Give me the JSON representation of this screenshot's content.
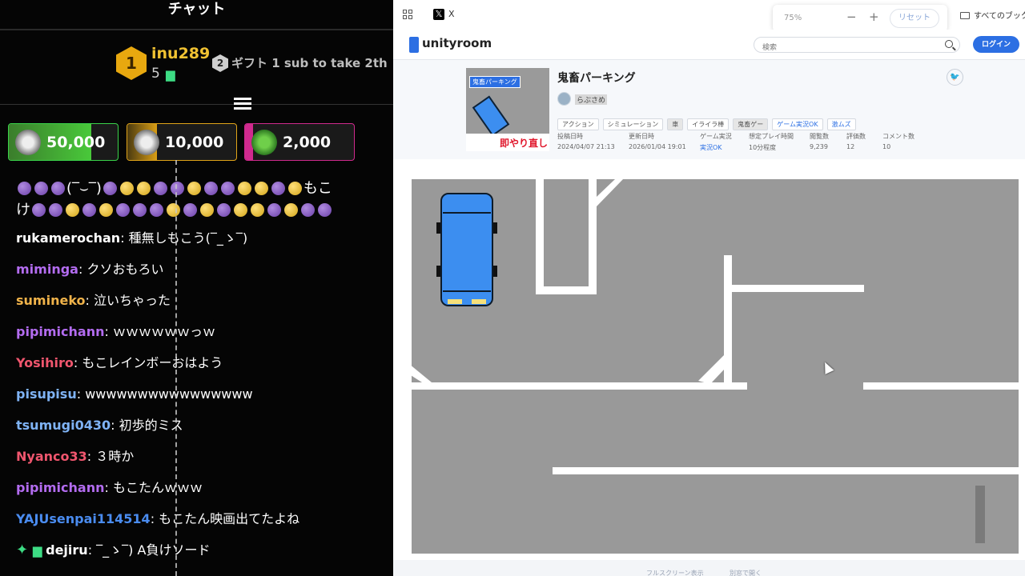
{
  "chat": {
    "title": "チャット",
    "top_gifter": {
      "rank": "1",
      "user": "inu289",
      "count": "5"
    },
    "second_gifter": {
      "rank": "2",
      "text": "ギフト 1 sub to take 2th"
    },
    "coin_boxes": [
      {
        "value": "50,000",
        "progress": 0.76,
        "color": "#49c93a"
      },
      {
        "value": "10,000",
        "progress": 0.27,
        "color": "#d99e16"
      },
      {
        "value": "2,000",
        "progress": 0.07,
        "color": "#d02a8e"
      }
    ],
    "emote_row1_text": "(‾⌣‾)",
    "emote_row1_tail": "もこ",
    "emote_row2_head": "け",
    "messages": [
      {
        "user": "rukamerochan",
        "color": "#ffffff",
        "text": "種無しもこう(‾_ゝ‾)"
      },
      {
        "user": "mimingа",
        "color": "#b36cf0",
        "text": "クソおもろい"
      },
      {
        "user": "sumineko",
        "color": "#f0b34a",
        "text": "泣いちゃった"
      },
      {
        "user": "pipimichann",
        "color": "#b36cf0",
        "text": "ｗｗｗｗｗｗっｗ"
      },
      {
        "user": "Yosihiro",
        "color": "#f0566e",
        "text": "もこレインボーおはよう"
      },
      {
        "user": "pisupisu",
        "color": "#7fb3f5",
        "text": "wwwwwwwwwwwwwwww"
      },
      {
        "user": "tsumugi0430",
        "color": "#7fb3f5",
        "text": "初歩的ミス"
      },
      {
        "user": "Nyanco33",
        "color": "#f0566e",
        "text": "３時か"
      },
      {
        "user": "pipimichann",
        "color": "#b36cf0",
        "text": "もこたんｗｗｗ"
      },
      {
        "user": "YAJUsenpai114514",
        "color": "#4a8cf0",
        "text": "もこたん映画出てたよね"
      },
      {
        "user": "dejiru",
        "color": "#ffffff",
        "text": "‾_ゝ‾) A負けソード"
      }
    ]
  },
  "browser": {
    "tab_label": "X",
    "zoom_level": "75%",
    "zoom_minus": "−",
    "zoom_plus": "+",
    "zoom_reset": "リセット",
    "bookmarks_label": "すべてのブックマ",
    "site": {
      "logo_text": "unityroom",
      "search_placeholder": "検索",
      "login_label": "ログイン"
    },
    "game": {
      "title": "鬼畜パーキング",
      "author": "らぶさめ",
      "thumb_label": "鬼畜パーキング",
      "thumb_banner": "即やり直し",
      "tags": [
        {
          "label": "アクション",
          "style": ""
        },
        {
          "label": "シミュレーション",
          "style": ""
        },
        {
          "label": "車",
          "style": "hl"
        },
        {
          "label": "イライラ棒",
          "style": ""
        },
        {
          "label": "鬼畜ゲー",
          "style": "hl"
        },
        {
          "label": "ゲーム実況OK",
          "style": "blue"
        },
        {
          "label": "激ムズ",
          "style": "blue"
        }
      ],
      "stats": [
        {
          "label": "投稿日時",
          "value": "2024/04/07 21:13",
          "link": false
        },
        {
          "label": "更新日時",
          "value": "2026/01/04 19:01",
          "link": false
        },
        {
          "label": "ゲーム実況",
          "value": "実況OK",
          "link": true
        },
        {
          "label": "想定プレイ時間",
          "value": "10分程度",
          "link": false
        },
        {
          "label": "閲覧数",
          "value": "9,239",
          "link": false
        },
        {
          "label": "評価数",
          "value": "12",
          "link": false
        },
        {
          "label": "コメント数",
          "value": "10",
          "link": false
        }
      ],
      "fullscreen_label": "フルスクリーン表示",
      "newwindow_label": "別窓で開く"
    }
  },
  "colors": {
    "asphalt": "#999999",
    "car": "#3c8ef0",
    "accent": "#2c6fe3"
  }
}
